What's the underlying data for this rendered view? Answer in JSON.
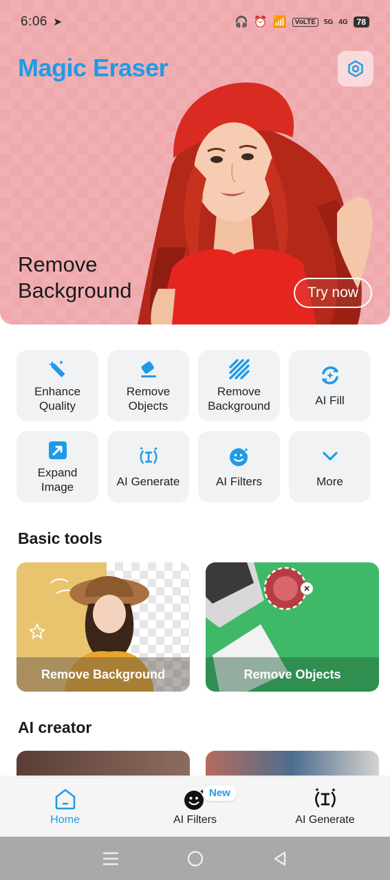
{
  "status": {
    "time": "6:06",
    "volte": "VoLTE",
    "net1": "5G",
    "net2": "4G",
    "battery": "78"
  },
  "hero": {
    "app_title": "Magic Eraser",
    "caption_line1": "Remove",
    "caption_line2": "Background",
    "try_label": "Try now"
  },
  "tools": [
    {
      "label": "Enhance Quality",
      "icon": "magic-wand-icon"
    },
    {
      "label": "Remove Objects",
      "icon": "eraser-icon"
    },
    {
      "label": "Remove Background",
      "icon": "stripes-icon"
    },
    {
      "label": "AI Fill",
      "icon": "ai-fill-icon"
    },
    {
      "label": "Expand Image",
      "icon": "expand-icon"
    },
    {
      "label": "AI Generate",
      "icon": "ai-generate-icon"
    },
    {
      "label": "AI Filters",
      "icon": "face-sparkle-icon"
    },
    {
      "label": "More",
      "icon": "chevron-down-icon"
    }
  ],
  "sections": {
    "basic_tools": "Basic tools",
    "ai_creator": "AI creator"
  },
  "basic_cards": [
    {
      "label": "Remove Background"
    },
    {
      "label": "Remove Objects"
    }
  ],
  "nav": {
    "home": "Home",
    "filters": "AI Filters",
    "generate": "AI Generate",
    "new_badge": "New"
  },
  "colors": {
    "accent": "#1e9be8",
    "hero_bg": "#efa9ad"
  }
}
